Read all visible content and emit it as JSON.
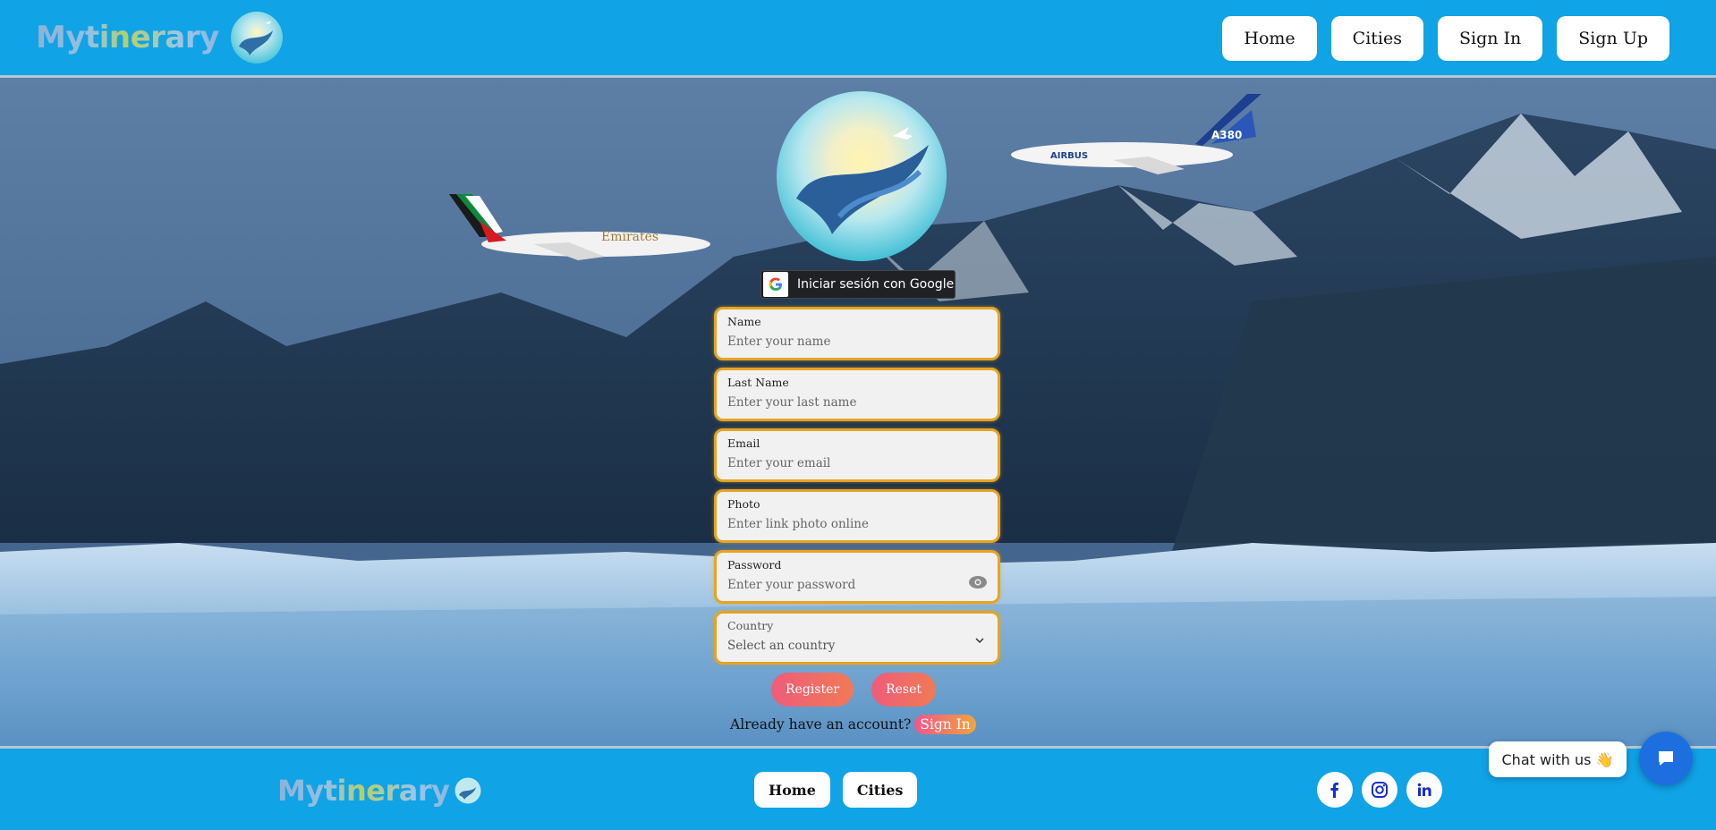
{
  "header": {
    "brand": "Mytinerary",
    "nav": [
      "Home",
      "Cities",
      "Sign In",
      "Sign Up"
    ]
  },
  "google": {
    "label": "Iniciar sesión con Google"
  },
  "form": {
    "fields": [
      {
        "label": "Name",
        "placeholder": "Enter your name"
      },
      {
        "label": "Last Name",
        "placeholder": "Enter your last name"
      },
      {
        "label": "Email",
        "placeholder": "Enter your email"
      },
      {
        "label": "Photo",
        "placeholder": "Enter link photo online"
      },
      {
        "label": "Password",
        "placeholder": "Enter your password"
      },
      {
        "label": "Country",
        "selected": "Select an country"
      }
    ],
    "register_label": "Register",
    "reset_label": "Reset",
    "already_text": "Already have an account?",
    "signin_link": "Sign In"
  },
  "plane_labels": {
    "emirates": "Emirates",
    "airbus": "AIRBUS",
    "model": "A380"
  },
  "footer": {
    "brand": "Mytinerary",
    "nav": [
      "Home",
      "Cities"
    ],
    "socials": [
      "facebook-icon",
      "instagram-icon",
      "linkedin-icon"
    ]
  },
  "chat": {
    "label": "Chat with us 👋"
  },
  "colors": {
    "primary": "#10a3e6",
    "field_border": "#e6a422",
    "chat": "#1d6fe0"
  }
}
